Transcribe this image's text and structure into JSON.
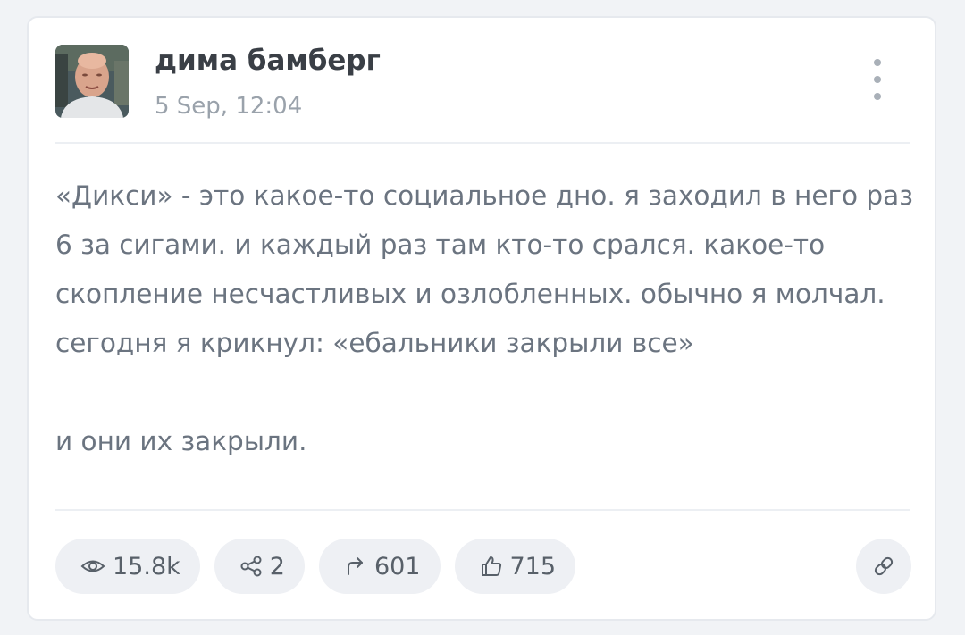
{
  "author": {
    "name": "дима бамберг",
    "date": "5 Sep, 12:04"
  },
  "post": {
    "paragraphs": [
      "«Дикси» - это какое-то социальное дно. я заходил в него раз 6 за сигами. и каждый раз там кто-то срался. какое-то скопление несчастливых и озлобленных. обычно я молчал. сегодня я крикнул: «ебальники закрыли все»",
      "и они их закрыли."
    ]
  },
  "stats": {
    "views": "15.8k",
    "shares": "2",
    "forwards": "601",
    "likes": "715"
  },
  "icons": {
    "views": "eye-icon",
    "shares": "share-nodes-icon",
    "forwards": "forward-arrow-icon",
    "likes": "thumbs-up-icon",
    "link": "link-icon",
    "more": "vertical-dots-icon"
  },
  "colors": {
    "background": "#f1f3f6",
    "card": "#ffffff",
    "name_text": "#3a3f46",
    "body_text": "#6b7480",
    "muted_text": "#9aa2ab",
    "pill": "#eef0f4"
  }
}
